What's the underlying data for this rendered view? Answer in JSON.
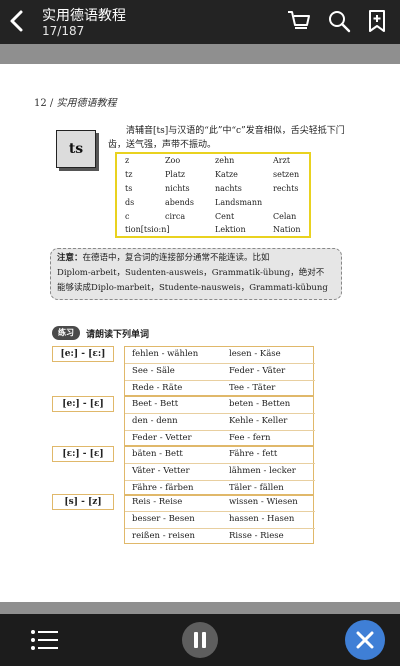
{
  "topbar": {
    "title": "实用德语教程",
    "page_indicator": "17/187"
  },
  "page": {
    "number": "12",
    "book_title": "实用德语教程",
    "ts_label": "ts",
    "intro": "清辅音[ts]与汉语的“此”中“c”发音相似，舌尖轻抵下门齿，送气强，声带不振动。",
    "word_table": [
      [
        "z",
        "Zoo",
        "zehn",
        "Arzt"
      ],
      [
        "tz",
        "Platz",
        "Katze",
        "setzen"
      ],
      [
        "ts",
        "nichts",
        "nachts",
        "rechts"
      ],
      [
        "ds",
        "abends",
        "Landsmann",
        ""
      ],
      [
        "c",
        "circa",
        "Cent",
        "Celan"
      ],
      [
        "tion[tsio:n]",
        "",
        "Lektion",
        "Nation"
      ]
    ],
    "note_label": "注意：",
    "note_line1": "在德语中，复合词的连接部分通常不能连读。比如",
    "note_line2": "Diplom-arbeit，Sudenten-ausweis，Grammatik-übung，绝对不",
    "note_line3": "能够读成Diplo-marbeit，Studente-nausweis，Grammati-kübung",
    "exercise_badge": "练习",
    "exercise_title": "请朗读下列单词",
    "groups": [
      {
        "label": "[e:] - [ɛ:]",
        "rows": [
          [
            "fehlen - wählen",
            "lesen - Käse"
          ],
          [
            "See - Säle",
            "Feder - Väter"
          ],
          [
            "Rede - Räte",
            "Tee - Täter"
          ]
        ]
      },
      {
        "label": "[e:] - [ɛ]",
        "rows": [
          [
            "Beet - Bett",
            "beten - Betten"
          ],
          [
            "den - denn",
            "Kehle - Keller"
          ],
          [
            "Feder - Vetter",
            "Fee - fern"
          ]
        ]
      },
      {
        "label": "[ɛ:] - [ɛ]",
        "rows": [
          [
            "bäten - Bett",
            "Fähre - fett"
          ],
          [
            "Väter - Vetter",
            "lähmen - lecker"
          ],
          [
            "Fähre - färben",
            "Täler - fällen"
          ]
        ]
      },
      {
        "label": "[s] - [z]",
        "rows": [
          [
            "Reis - Reise",
            "wissen - Wiesen"
          ],
          [
            "besser - Besen",
            "hassen - Hasen"
          ],
          [
            "reißen - reisen",
            "Risse - Riese"
          ]
        ]
      }
    ]
  },
  "icons": {
    "back": "back-arrow-icon",
    "cart": "cart-icon",
    "search": "search-icon",
    "bookmark": "bookmark-add-icon",
    "menu": "menu-icon",
    "pause": "pause-icon",
    "close": "close-icon"
  },
  "colors": {
    "accent_blue": "#3f7fd6",
    "highlight_yellow": "#e9d21f",
    "bar_dark": "#232323"
  }
}
